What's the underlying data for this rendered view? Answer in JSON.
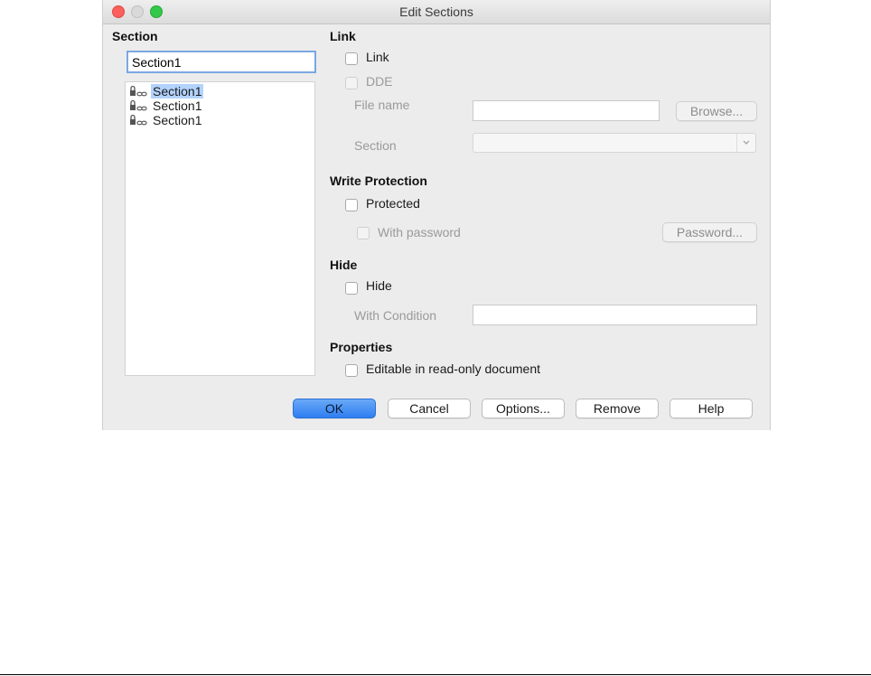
{
  "window": {
    "title": "Edit Sections"
  },
  "section": {
    "heading": "Section",
    "name_value": "Section1",
    "items": [
      {
        "label": "Section1",
        "selected": true
      },
      {
        "label": "Section1",
        "selected": false
      },
      {
        "label": "Section1",
        "selected": false
      }
    ]
  },
  "link": {
    "heading": "Link",
    "link_label": "Link",
    "dde_label": "DDE",
    "file_name_label": "File name",
    "file_name_value": "",
    "browse_label": "Browse...",
    "section_label": "Section",
    "section_value": ""
  },
  "write_protection": {
    "heading": "Write Protection",
    "protected_label": "Protected",
    "with_password_label": "With password",
    "password_button": "Password..."
  },
  "hide": {
    "heading": "Hide",
    "hide_label": "Hide",
    "condition_label": "With Condition",
    "condition_value": ""
  },
  "properties": {
    "heading": "Properties",
    "editable_label": "Editable in read-only document"
  },
  "buttons": {
    "ok": "OK",
    "cancel": "Cancel",
    "options": "Options...",
    "remove": "Remove",
    "help": "Help"
  }
}
